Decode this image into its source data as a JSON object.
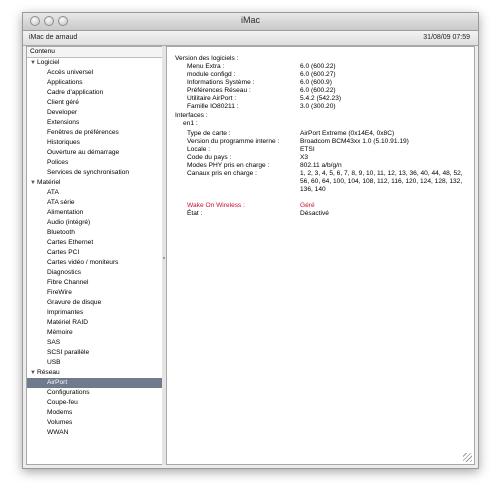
{
  "window": {
    "title": "iMac"
  },
  "infobar": {
    "left": "iMac de arnaud",
    "right": "31/08/09 07:59"
  },
  "sidebar": {
    "header": "Contenu",
    "categories": [
      {
        "label": "Logiciel",
        "items": [
          "Accès universel",
          "Applications",
          "Cadre d'application",
          "Client géré",
          "Developer",
          "Extensions",
          "Fenêtres de préférences",
          "Historiques",
          "Ouverture au démarrage",
          "Polices",
          "Services de synchronisation"
        ]
      },
      {
        "label": "Matériel",
        "items": [
          "ATA",
          "ATA série",
          "Alimentation",
          "Audio (intégré)",
          "Bluetooth",
          "Cartes Ethernet",
          "Cartes PCI",
          "Cartes vidéo / moniteurs",
          "Diagnostics",
          "Fibre Channel",
          "FireWire",
          "Gravure de disque",
          "Imprimantes",
          "Matériel RAID",
          "Mémoire",
          "SAS",
          "SCSI parallèle",
          "USB"
        ]
      },
      {
        "label": "Réseau",
        "items": [
          "AirPort",
          "Configurations",
          "Coupe-feu",
          "Modems",
          "Volumes",
          "WWAN"
        ]
      }
    ],
    "selected": "AirPort"
  },
  "detail": {
    "software_header": "Version des logiciels :",
    "software": [
      {
        "k": "Menu Extra :",
        "v": "6.0 (600.22)"
      },
      {
        "k": "module configd :",
        "v": "6.0 (600.27)"
      },
      {
        "k": "Informations Système :",
        "v": "6.0 (600.9)"
      },
      {
        "k": "Préférences Réseau :",
        "v": "6.0 (600.22)"
      },
      {
        "k": "Utilitaire AirPort :",
        "v": "5.4.2 (542.23)"
      },
      {
        "k": "Famille IO80211 :",
        "v": "3.0 (300.20)"
      }
    ],
    "interfaces_header": "Interfaces :",
    "interface_name": "en1 :",
    "iface": [
      {
        "k": "Type de carte :",
        "v": "AirPort Extreme  (0x14E4, 0x8C)"
      },
      {
        "k": "Version du programme interne :",
        "v": "Broadcom BCM43xx 1.0 (5.10.91.19)"
      },
      {
        "k": "Locale :",
        "v": "ETSI"
      },
      {
        "k": "Code du pays :",
        "v": "X3"
      },
      {
        "k": "Modes PHY pris en charge :",
        "v": "802.11 a/b/g/n"
      }
    ],
    "channels_label": "Canaux pris en charge :",
    "channels_value": "1, 2, 3, 4, 5, 6, 7, 8, 9, 10, 11, 12, 13, 36, 40, 44, 48, 52, 56, 60, 64, 100, 104, 108, 112, 116, 120, 124, 128, 132, 136, 140",
    "wow_label": "Wake On Wireless :",
    "wow_value": "Géré",
    "state_label": "État :",
    "state_value": "Désactivé"
  }
}
